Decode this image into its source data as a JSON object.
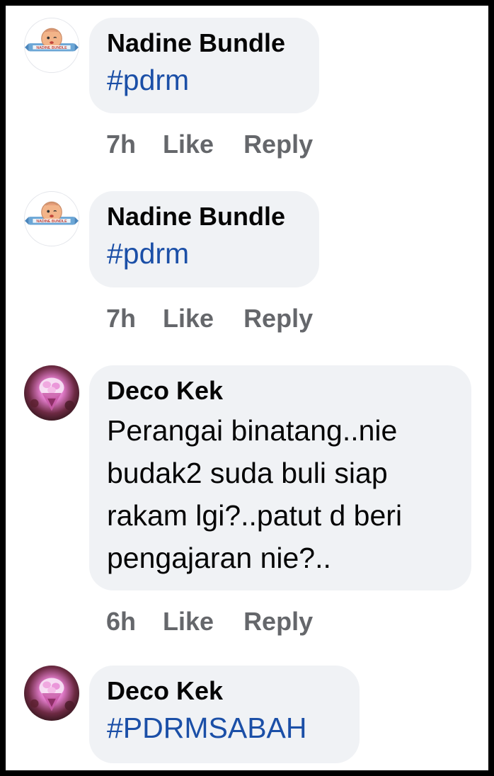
{
  "comments": [
    {
      "author": "Nadine Bundle",
      "text": "#pdrm",
      "time": "7h",
      "like_label": "Like",
      "reply_label": "Reply",
      "avatar": "nadine-bundle-baby-logo"
    },
    {
      "author": "Nadine Bundle",
      "text": "#pdrm",
      "time": "7h",
      "like_label": "Like",
      "reply_label": "Reply",
      "avatar": "nadine-bundle-baby-logo"
    },
    {
      "author": "Deco Kek",
      "text_lines": [
        "Perangai binatang..nie",
        "budak2 suda buli siap",
        "rakam lgi?..patut d beri",
        "pengajaran nie?.."
      ],
      "time": "6h",
      "like_label": "Like",
      "reply_label": "Reply",
      "avatar": "pink-flower-bouquet-photo"
    },
    {
      "author": "Deco Kek",
      "text": "#PDRMSABAH",
      "avatar": "pink-flower-bouquet-photo"
    }
  ],
  "colors": {
    "bubble": "#f0f2f5",
    "hashtag": "#1b4fa7",
    "action_text": "#65676b",
    "name_text": "#050505"
  }
}
